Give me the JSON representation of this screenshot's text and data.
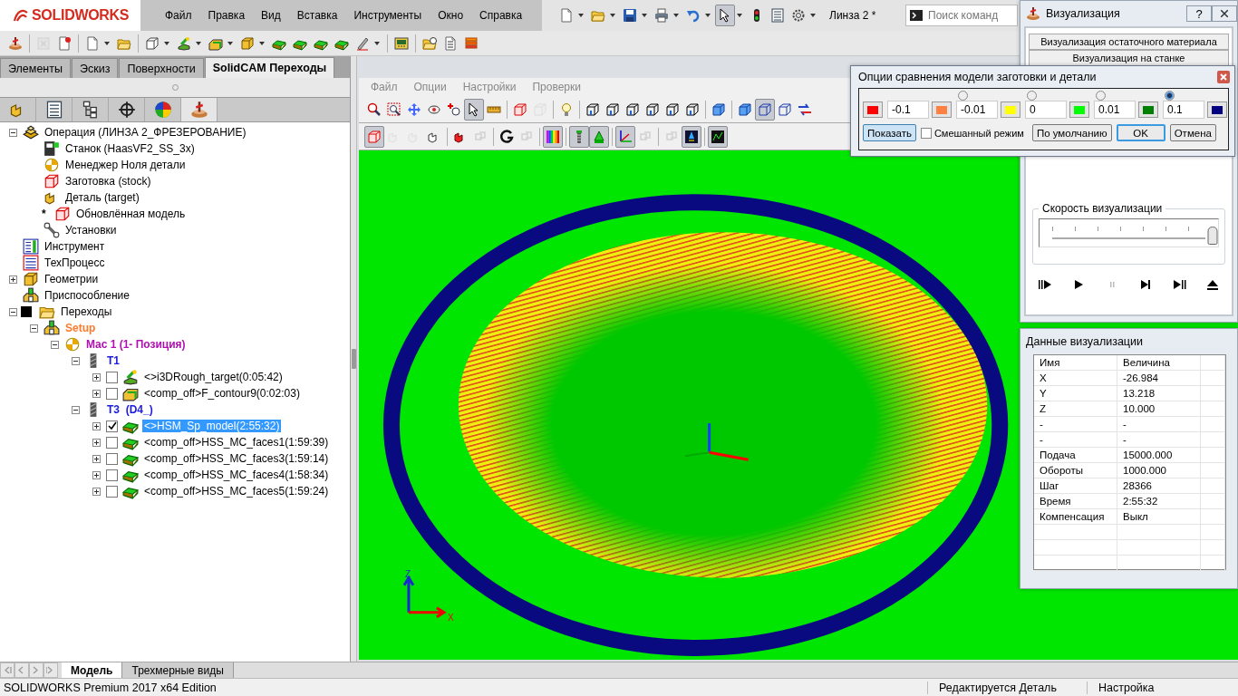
{
  "logo": {
    "text": "SOLIDWORKS"
  },
  "menu": [
    "Файл",
    "Правка",
    "Вид",
    "Вставка",
    "Инструменты",
    "Окно",
    "Справка"
  ],
  "quick_toolbar": [
    {
      "pressed": false
    },
    {
      "pressed": false
    },
    {
      "pressed": false
    },
    {
      "pressed": false
    },
    {
      "pressed": false
    },
    {
      "pressed": true
    },
    {
      "pressed": false
    },
    {
      "pressed": false
    },
    {
      "pressed": false
    }
  ],
  "document_title": "Линза 2 *",
  "search": {
    "placeholder": "Поиск команд"
  },
  "main_toolbar": [
    {
      "disabled": false
    },
    {
      "disabled": true
    },
    {
      "disabled": false
    },
    {
      "disabled": false
    },
    {
      "disabled": false
    },
    {
      "disabled": false
    },
    {
      "disabled": false
    },
    {
      "disabled": false
    },
    {
      "disabled": false
    },
    {
      "disabled": false
    },
    {
      "disabled": false
    },
    {
      "disabled": false
    },
    {
      "disabled": false
    },
    {
      "disabled": false
    },
    {
      "disabled": false
    },
    {
      "disabled": false
    },
    {
      "disabled": false
    },
    {
      "disabled": false
    }
  ],
  "left_tabs": [
    {
      "label": "Элементы",
      "selected": false
    },
    {
      "label": "Эскиз",
      "selected": false
    },
    {
      "label": "Поверхности",
      "selected": false
    },
    {
      "label": "SolidCAM Переходы",
      "selected": true
    }
  ],
  "panel_tabs": [
    {
      "selected": false
    },
    {
      "selected": false
    },
    {
      "selected": false
    },
    {
      "selected": false
    },
    {
      "selected": false
    },
    {
      "selected": true
    }
  ],
  "tree": [
    {
      "label": "Операция (ЛИНЗА 2_ФРЕЗЕРОВАНИЕ)",
      "kind": "operation",
      "expanded": true,
      "selected": false,
      "children": [
        {
          "label": "Станок (HaasVF2_SS_3x)",
          "kind": "machine",
          "selected": false
        },
        {
          "label": "Менеджер Ноля детали",
          "kind": "zero",
          "selected": false
        },
        {
          "label": "Заготовка (stock)",
          "kind": "stock",
          "selected": false
        },
        {
          "label": "Деталь (target)",
          "kind": "target",
          "selected": false
        },
        {
          "label": "Обновлённая модель",
          "kind": "model",
          "prefix": "*",
          "selected": false
        },
        {
          "label": "Установки",
          "kind": "settings",
          "selected": false
        }
      ]
    },
    {
      "label": "Инструмент",
      "kind": "tools",
      "selected": false
    },
    {
      "label": "ТехПроцесс",
      "kind": "process",
      "selected": false
    },
    {
      "label": "Геометрии",
      "kind": "geometry",
      "expanded": false,
      "selected": false
    },
    {
      "label": "Приспособление",
      "kind": "fixture",
      "selected": false
    },
    {
      "label": "Переходы",
      "kind": "operations",
      "expanded": true,
      "selected": false,
      "children": [
        {
          "label": "Setup",
          "kind": "setup",
          "expanded": true,
          "selected": false,
          "children": [
            {
              "label": "Mac 1 (1- Позиция)",
              "kind": "position",
              "expanded": true,
              "selected": false,
              "children": [
                {
                  "label": "T1",
                  "kind": "toolgroup",
                  "expanded": true,
                  "selected": false,
                  "children": [
                    {
                      "label": "<>i3DRough_target(0:05:42)",
                      "kind": "rough",
                      "expanded": false,
                      "checked": false,
                      "selected": false
                    },
                    {
                      "label": "<comp_off>F_contour9(0:02:03)",
                      "kind": "contour",
                      "expanded": false,
                      "checked": false,
                      "selected": false
                    }
                  ]
                },
                {
                  "label": "T3  (D4_)",
                  "kind": "toolgroup",
                  "expanded": true,
                  "selected": false,
                  "children": [
                    {
                      "label": "<>HSM_Sp_model(2:55:32)",
                      "kind": "hsm",
                      "expanded": false,
                      "checked": true,
                      "selected": true
                    },
                    {
                      "label": "<comp_off>HSS_MC_faces1(1:59:39)",
                      "kind": "hsm",
                      "expanded": false,
                      "checked": false,
                      "selected": false
                    },
                    {
                      "label": "<comp_off>HSS_MC_faces3(1:59:14)",
                      "kind": "hsm",
                      "expanded": false,
                      "checked": false,
                      "selected": false
                    },
                    {
                      "label": "<comp_off>HSS_MC_faces4(1:58:34)",
                      "kind": "hsm",
                      "expanded": false,
                      "checked": false,
                      "selected": false
                    },
                    {
                      "label": "<comp_off>HSS_MC_faces5(1:59:24)",
                      "kind": "hsm",
                      "expanded": false,
                      "checked": false,
                      "selected": false
                    }
                  ]
                }
              ]
            }
          ]
        }
      ]
    }
  ],
  "viewport": {
    "menu": [
      "Файл",
      "Опции",
      "Настройки",
      "Проверки"
    ],
    "toolbar_1": [
      {
        "pressed": false,
        "disabled": false
      },
      {
        "pressed": false,
        "disabled": false
      },
      {
        "pressed": false,
        "disabled": false
      },
      {
        "pressed": false,
        "disabled": false
      },
      {
        "pressed": false,
        "disabled": false
      },
      {
        "pressed": true,
        "disabled": false
      },
      {
        "pressed": false,
        "disabled": false
      },
      {
        "pressed": false,
        "disabled": false
      },
      {
        "pressed": false,
        "disabled": true
      },
      {
        "pressed": false,
        "disabled": false
      },
      {
        "pressed": false,
        "disabled": false
      },
      {
        "pressed": false,
        "disabled": false
      },
      {
        "pressed": false,
        "disabled": false
      },
      {
        "pressed": false,
        "disabled": false
      },
      {
        "pressed": false,
        "disabled": false
      },
      {
        "pressed": false,
        "disabled": false
      },
      {
        "pressed": false,
        "disabled": false
      },
      {
        "pressed": false,
        "disabled": false
      },
      {
        "pressed": true,
        "disabled": false
      },
      {
        "pressed": false,
        "disabled": false
      },
      {
        "pressed": false,
        "disabled": false
      }
    ],
    "toolbar_2": [
      {
        "pressed": true,
        "disabled": false
      },
      {
        "pressed": false,
        "disabled": true
      },
      {
        "pressed": false,
        "disabled": true
      },
      {
        "pressed": false,
        "disabled": false
      },
      {
        "pressed": false,
        "disabled": false
      },
      {
        "pressed": false,
        "disabled": true
      },
      {
        "pressed": false,
        "disabled": false
      },
      {
        "pressed": false,
        "disabled": true
      },
      {
        "pressed": true,
        "disabled": false
      },
      {
        "pressed": true,
        "disabled": false
      },
      {
        "pressed": true,
        "disabled": false
      },
      {
        "pressed": true,
        "disabled": false
      },
      {
        "pressed": false,
        "disabled": true
      },
      {
        "pressed": false,
        "disabled": true
      },
      {
        "pressed": true,
        "disabled": false
      },
      {
        "pressed": true,
        "disabled": false
      }
    ],
    "axis_labels": [
      "Z",
      "X"
    ]
  },
  "visualization": {
    "title": "Визуализация",
    "help": "?",
    "mode_buttons": [
      "Визуализация остаточного материала",
      "Визуализация на станке"
    ],
    "speed": {
      "label": "Скорость визуализации",
      "level": 0.97
    },
    "playback": [
      {
        "disabled": false
      },
      {
        "disabled": false
      },
      {
        "disabled": true
      },
      {
        "disabled": false
      },
      {
        "disabled": false
      },
      {
        "disabled": false
      }
    ]
  },
  "data_panel": {
    "title": "Данные визуализации",
    "columns": [
      "Имя",
      "Величина"
    ],
    "rows": [
      [
        "X",
        "-26.984"
      ],
      [
        "Y",
        "13.218"
      ],
      [
        "Z",
        "10.000"
      ],
      [
        "-",
        "-"
      ],
      [
        "-",
        "-"
      ],
      [
        "Подача",
        "15000.000"
      ],
      [
        "Обороты",
        "1000.000"
      ],
      [
        "Шаг",
        "28366"
      ],
      [
        "Время",
        "2:55:32"
      ],
      [
        "Компенсация",
        "Выкл"
      ]
    ]
  },
  "compare_dialog": {
    "title": "Опции сравнения модели заготовки и детали",
    "swatches": [
      {
        "color": "#ff0000"
      },
      {
        "color": "#ff8040"
      },
      {
        "color": "#ffff00"
      },
      {
        "color": "#00ff00"
      },
      {
        "color": "#008000"
      },
      {
        "color": "#000080"
      }
    ],
    "thresholds": [
      "-0.1",
      "-0.01",
      "0",
      "0.01",
      "0.1"
    ],
    "radios": [
      {
        "selected": false
      },
      {
        "selected": false
      },
      {
        "selected": false
      },
      {
        "selected": true
      }
    ],
    "actions": [
      {
        "kind": "button",
        "label": "Показать",
        "highlighted": true,
        "default": false
      },
      {
        "kind": "checkbox",
        "label": "Смешанный режим",
        "checked": false
      },
      {
        "kind": "button",
        "label": "По умолчанию",
        "highlighted": false,
        "default": false
      },
      {
        "kind": "button",
        "label": "OK",
        "highlighted": false,
        "default": true
      },
      {
        "kind": "button",
        "label": "Отмена",
        "highlighted": false,
        "default": false
      }
    ]
  },
  "bottom_tabs": [
    {
      "label": "Модель",
      "selected": true
    },
    {
      "label": "Трехмерные виды",
      "selected": false
    }
  ],
  "status_bar": {
    "edition": "SOLIDWORKS Premium 2017 x64 Edition",
    "mode": "Редактируется Деталь",
    "setting": "Настройка"
  }
}
